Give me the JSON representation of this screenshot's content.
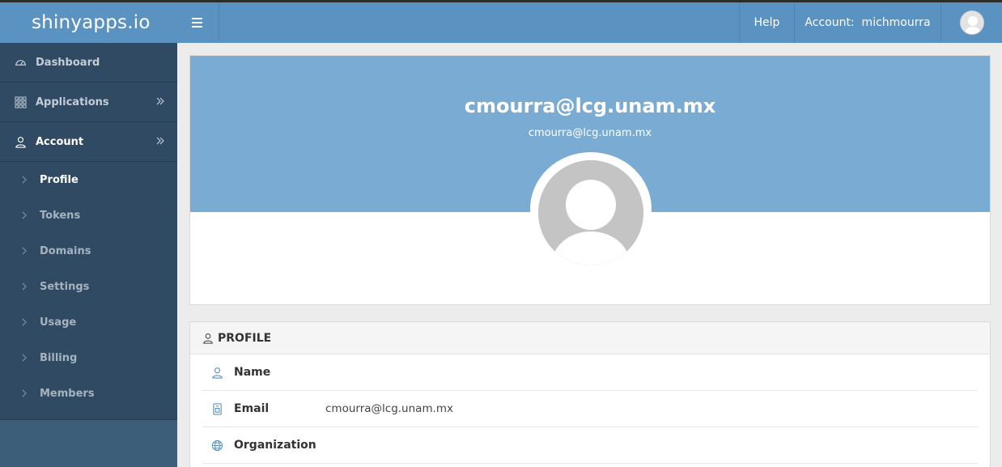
{
  "header": {
    "brand": "shinyapps.io",
    "help_label": "Help",
    "account_label": "Account:  michmourra"
  },
  "sidebar": {
    "items": [
      {
        "label": "Dashboard",
        "icon": "dashboard-icon"
      },
      {
        "label": "Applications",
        "icon": "grid-icon"
      },
      {
        "label": "Account",
        "icon": "user-icon"
      }
    ],
    "account_submenu": [
      {
        "label": "Profile",
        "active": true
      },
      {
        "label": "Tokens"
      },
      {
        "label": "Domains"
      },
      {
        "label": "Settings"
      },
      {
        "label": "Usage"
      },
      {
        "label": "Billing"
      },
      {
        "label": "Members"
      }
    ]
  },
  "profile_header": {
    "title": "cmourra@lcg.unam.mx",
    "subtitle": "cmourra@lcg.unam.mx"
  },
  "profile": {
    "section_title": "PROFILE",
    "rows": [
      {
        "label": "Name",
        "value": "",
        "icon": "user-icon"
      },
      {
        "label": "Email",
        "value": "cmourra@lcg.unam.mx",
        "icon": "id-card-icon"
      },
      {
        "label": "Organization",
        "value": "",
        "icon": "globe-icon"
      }
    ]
  },
  "colors": {
    "header_bg": "#5a93c2",
    "sidebar_bg": "#2f4a62",
    "banner_bg": "#7aacd3",
    "accent_icon": "#5a93c2"
  }
}
